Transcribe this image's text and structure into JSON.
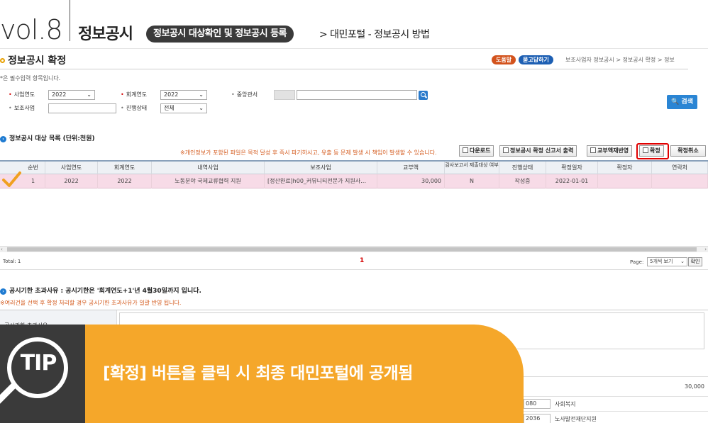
{
  "guide": {
    "vol": "vol.8",
    "title": "정보공시",
    "pill": "정보공시 대상확인 및 정보공시 등록",
    "crumb": "> 대민포털 - 정보공시 방법"
  },
  "app": {
    "page_title": "정보공시 확정",
    "help_label": "도움말",
    "qa_label": "묻고답하기",
    "breadcrumb": "보조사업자 정보공시 > 정보공시 확정 > 정보",
    "required_note": "*은 필수입력 항목입니다."
  },
  "search": {
    "project_year_label": "사업연도",
    "project_year_value": "2022",
    "fiscal_year_label": "회계연도",
    "fiscal_year_value": "2022",
    "ministry_label": "중앙관서",
    "subsidy_label": "보조사업",
    "progress_label": "진행상태",
    "progress_value": "전체",
    "search_button": "검색"
  },
  "list": {
    "section_title": "정보공시 대상 목록 (단위:천원)",
    "warning": "※개인정보가 포함된 파일은 목적 달성 후 즉시 파기하시고, 유출 등 문제 발생 시 책임이 발생할 수 있습니다.",
    "buttons": {
      "download": "다운로드",
      "print_report": "정보공시 확정 신고서 출력",
      "apply_amount": "교부액재반영",
      "confirm": "확정",
      "cancel_confirm": "확정취소"
    },
    "columns": [
      "순번",
      "사업연도",
      "회계연도",
      "내역사업",
      "보조사업",
      "교부액",
      "감사보고서 제출대상 여부",
      "진행상태",
      "확정일자",
      "확정자",
      "연락처"
    ],
    "rows": [
      {
        "no": "1",
        "project_year": "2022",
        "fiscal_year": "2022",
        "detail": "노동분야 국제교류협력 지원",
        "subsidy": "[정산완료]h00_커뮤니티전문가 지원사…",
        "amount": "30,000",
        "audit": "N",
        "status": "작성중",
        "confirm_date": "2022-01-01",
        "confirmer": "",
        "contact": ""
      }
    ]
  },
  "pager": {
    "total": "Total: 1",
    "current_page": "1",
    "page_label": "Page:",
    "page_size": "5개씩 보기",
    "go_button": "확인"
  },
  "overdue": {
    "title": "공시기한 초과사유 : 공시기한은 '회계연도+1'년 4월30일까지 입니다.",
    "note": "※여러건을 선택 후 확정 처리할 경우 공시기한 초과사유가 일괄 반영 됩니다.",
    "field_label": "공시기한 초과사유"
  },
  "bottom": {
    "amount": "30,000",
    "rows": [
      {
        "code": "080",
        "name": "사회복지"
      },
      {
        "code": "2036",
        "name": "노사발전재단지원"
      }
    ]
  },
  "tip": {
    "badge": "TIP",
    "message": "[확정] 버튼을 클릭 시 최종 대민포털에 공개됨"
  },
  "colors": {
    "accent_orange": "#f5a72a",
    "tip_dark": "#3a3a3a",
    "highlight_red": "#e00000",
    "selected_row": "#f7dbe7",
    "primary_blue": "#2a85d4"
  }
}
